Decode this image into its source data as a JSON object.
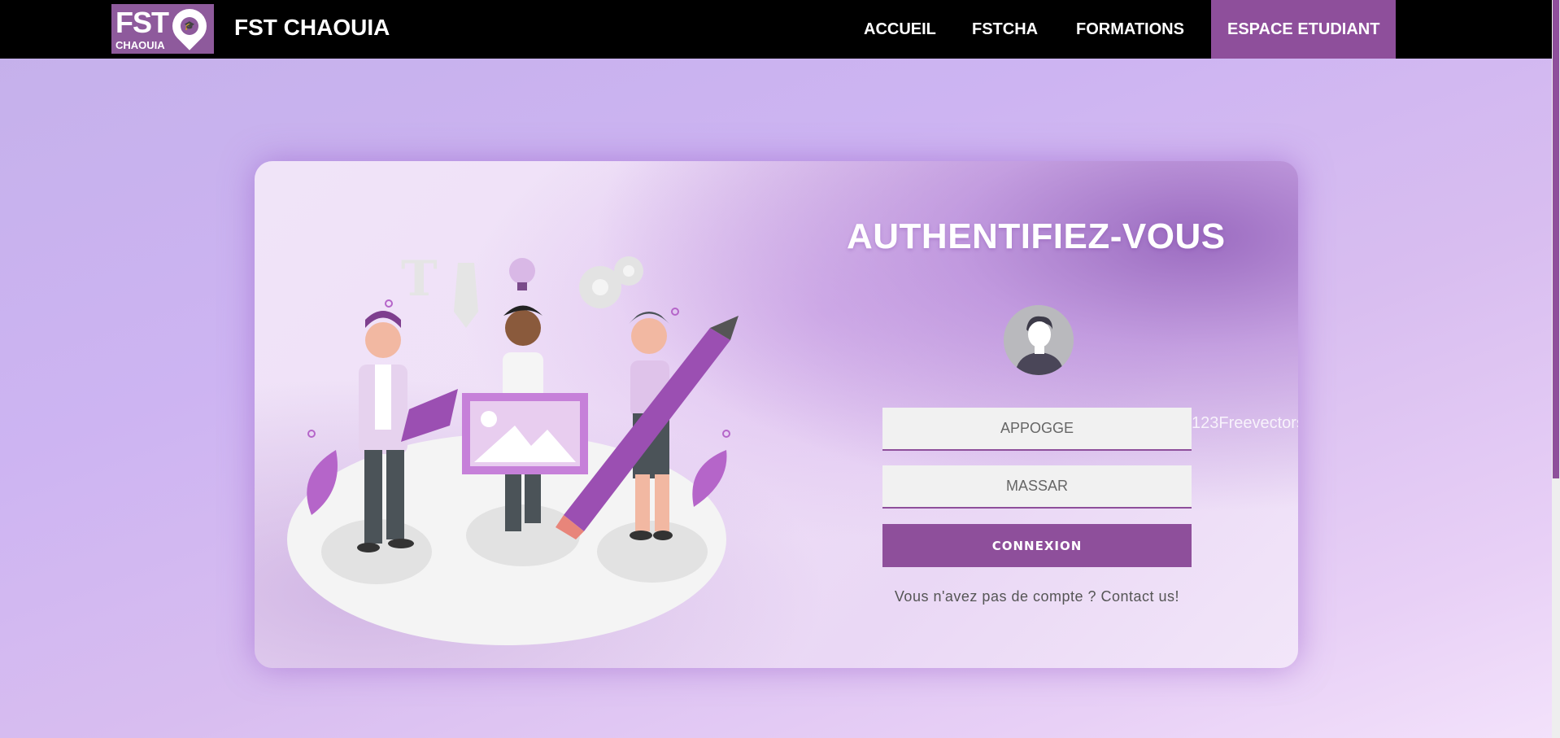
{
  "nav": {
    "logo_text_top": "FST",
    "logo_text_bottom": "CHAOUIA",
    "brand": "FST CHAOUIA",
    "items": [
      {
        "label": "ACCUEIL"
      },
      {
        "label": "FSTCHA"
      },
      {
        "label": "FORMATIONS"
      },
      {
        "label": "ESPACE ETUDIANT"
      }
    ]
  },
  "login": {
    "title": "AUTHENTIFIEZ-VOUS",
    "apogee_placeholder": "APPOGGE",
    "massar_placeholder": "MASSAR",
    "submit_label": "CONNEXION",
    "footer_text": "Vous n'avez pas de compte ? Contact us!",
    "watermark": "123Freevectors"
  },
  "colors": {
    "accent": "#8e4f9b",
    "navbar": "#000000"
  }
}
